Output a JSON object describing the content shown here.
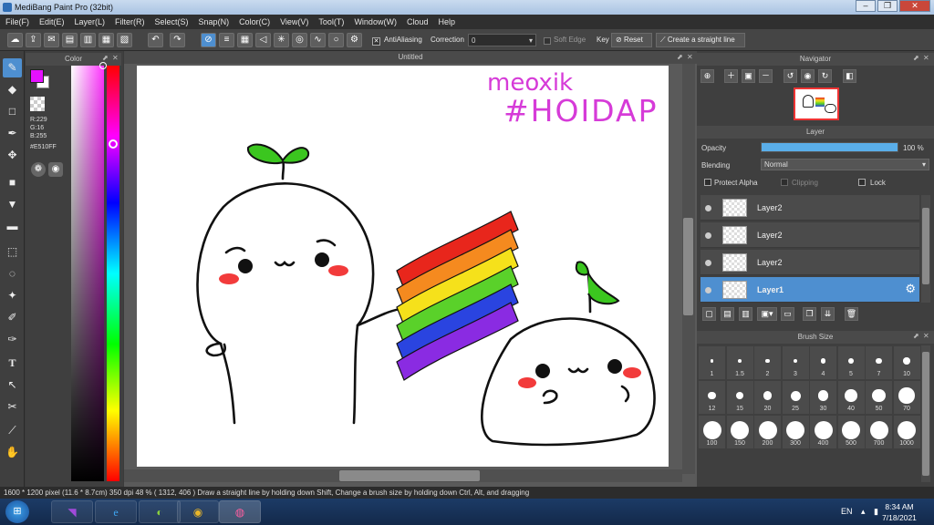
{
  "window": {
    "title": "MediBang Paint Pro (32bit)",
    "min": "–",
    "max": "❐",
    "close": "✕"
  },
  "menu": [
    "File(F)",
    "Edit(E)",
    "Layer(L)",
    "Filter(R)",
    "Select(S)",
    "Snap(N)",
    "Color(C)",
    "View(V)",
    "Tool(T)",
    "Window(W)",
    "Cloud",
    "Help"
  ],
  "toolbar": {
    "antialiasing": "AntiAliasing",
    "correction_label": "Correction",
    "correction_value": "0",
    "soft_edge": "Soft Edge",
    "key": "Key",
    "reset": "Reset",
    "straight_line": "Create a straight line"
  },
  "color_panel": {
    "title": "Color",
    "r": "R:229",
    "g": "G:16",
    "b": "B:255",
    "hex": "#E510FF",
    "fg": "#E510FF",
    "bg": "#ffffff"
  },
  "canvas_tab": {
    "title": "Untitled"
  },
  "artwork": {
    "line1": "meoxik",
    "line2": "#HOIDAP",
    "flag_colors": [
      "#e8261c",
      "#f58a1f",
      "#f5e11b",
      "#5ad12a",
      "#2a44e0",
      "#8a2be2"
    ]
  },
  "navigator": {
    "title": "Navigator"
  },
  "layer_panel": {
    "title": "Layer",
    "opacity_label": "Opacity",
    "opacity_value": "100 %",
    "opacity_level": 1.0,
    "blending_label": "Blending",
    "blending_value": "Normal",
    "protect_alpha": "Protect Alpha",
    "clipping": "Clipping",
    "lock": "Lock",
    "layers": [
      {
        "name": "Layer2"
      },
      {
        "name": "Layer2"
      },
      {
        "name": "Layer2"
      },
      {
        "name": "Layer1",
        "selected": true
      }
    ]
  },
  "brush_size": {
    "title": "Brush Size",
    "sizes": [
      "1",
      "1.5",
      "2",
      "3",
      "4",
      "5",
      "7",
      "10",
      "12",
      "15",
      "20",
      "25",
      "30",
      "40",
      "50",
      "70",
      "100",
      "150",
      "200",
      "300",
      "400",
      "500",
      "700",
      "1000"
    ]
  },
  "status": {
    "text": "1600 * 1200 pixel   (11.6 * 8.7cm)   350 dpi   48 %   ( 1312, 406 )   Draw a straight line by holding down Shift, Change a brush size by holding down Ctrl, Alt, and dragging"
  },
  "taskbar": {
    "lang": "EN",
    "time": "8:34 AM",
    "date": "7/18/2021"
  }
}
